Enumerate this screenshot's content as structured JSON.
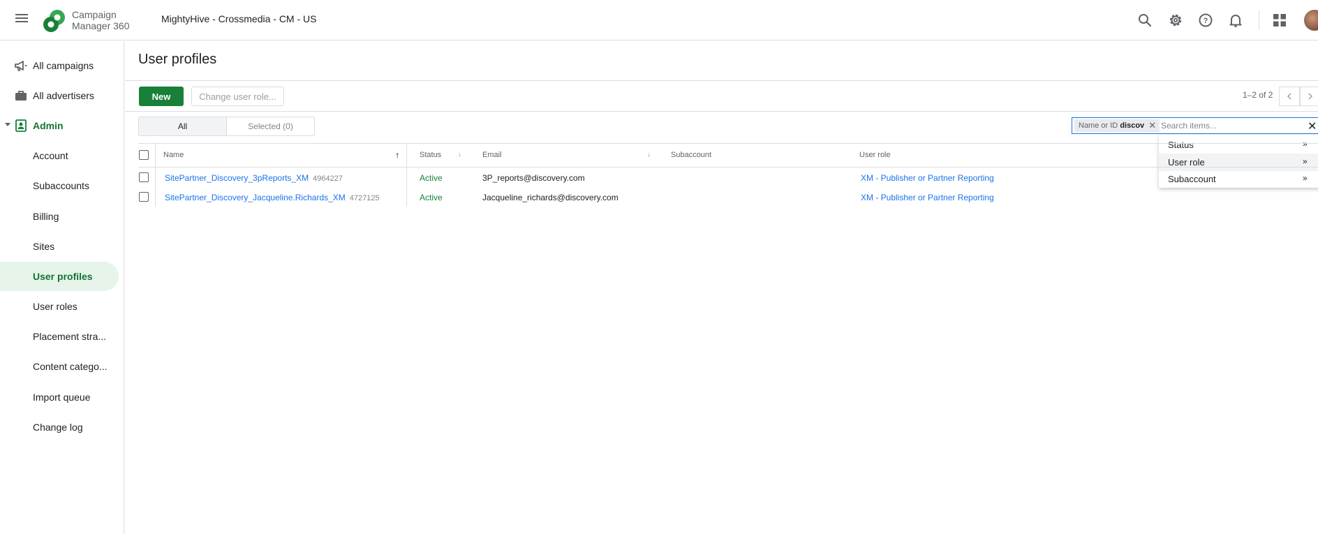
{
  "header": {
    "product_name_line1": "Campaign",
    "product_name_line2": "Manager 360",
    "account_name": "MightyHive - Crossmedia - CM - US"
  },
  "sidebar": {
    "items": [
      {
        "label": "All campaigns",
        "icon": "megaphone-icon"
      },
      {
        "label": "All advertisers",
        "icon": "briefcase-icon"
      },
      {
        "label": "Admin",
        "icon": "admin-icon"
      },
      {
        "label": "Account"
      },
      {
        "label": "Subaccounts"
      },
      {
        "label": "Billing"
      },
      {
        "label": "Sites"
      },
      {
        "label": "User profiles"
      },
      {
        "label": "User roles"
      },
      {
        "label": "Placement stra..."
      },
      {
        "label": "Content catego..."
      },
      {
        "label": "Import queue"
      },
      {
        "label": "Change log"
      }
    ],
    "active_item": "User profiles"
  },
  "page": {
    "title": "User profiles",
    "new_button": "New",
    "change_role_button": "Change user role...",
    "pager_text": "1–2 of 2",
    "tab_all": "All",
    "tab_selected": "Selected (0)"
  },
  "filter": {
    "chip_label": "Name or ID",
    "chip_value": "discov",
    "placeholder": "Search items...",
    "dropdown_options": [
      "Status",
      "User role",
      "Subaccount"
    ]
  },
  "table": {
    "columns": [
      "Name",
      "Status",
      "Email",
      "Subaccount",
      "User role"
    ],
    "rows": [
      {
        "name": "SitePartner_Discovery_3pReports_XM",
        "id": "4964227",
        "status": "Active",
        "email": "3P_reports@discovery.com",
        "subaccount": "",
        "user_role": "XM - Publisher or Partner Reporting"
      },
      {
        "name": "SitePartner_Discovery_Jacqueline.Richards_XM",
        "id": "4727125",
        "status": "Active",
        "email": "Jacqueline_richards@discovery.com",
        "subaccount": "",
        "user_role": "XM - Publisher or Partner Reporting"
      }
    ]
  },
  "colors": {
    "brand_green": "#188038",
    "link_blue": "#1a73e8",
    "active_nav_bg": "#e6f4ea"
  }
}
